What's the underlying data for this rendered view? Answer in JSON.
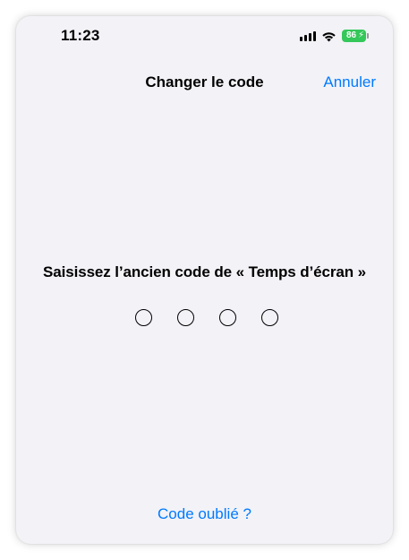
{
  "status_bar": {
    "time": "11:23",
    "battery_level": "86",
    "icons": [
      "signal-icon",
      "wifi-icon",
      "battery-icon",
      "charging-bolt-icon"
    ]
  },
  "nav": {
    "title": "Changer le code",
    "cancel_label": "Annuler"
  },
  "passcode": {
    "prompt": "Saisissez l’ancien code de « Temps d’écran »",
    "digit_count": 4,
    "entered_count": 0
  },
  "footer": {
    "forgot_label": "Code oublié ?"
  },
  "colors": {
    "accent": "#007aff",
    "background": "#f2f2f7",
    "battery": "#34c759",
    "text": "#000000"
  }
}
